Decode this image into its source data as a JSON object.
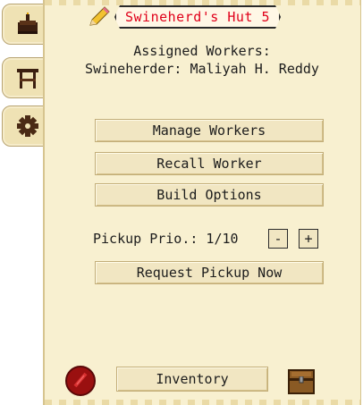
{
  "side_tabs": [
    {
      "icon": "cake-icon"
    },
    {
      "icon": "workbench-icon"
    },
    {
      "icon": "gear-icon"
    }
  ],
  "header": {
    "title": "Swineherd's Hut 5",
    "edit_icon": "pencil-icon",
    "title_color": "#e0001a"
  },
  "info": {
    "assigned_heading": "Assigned Workers:",
    "worker_line": "Swineherder: Maliyah H. Reddy"
  },
  "buttons": {
    "manage_workers": "Manage Workers",
    "recall_worker": "Recall Worker",
    "build_options": "Build Options",
    "request_pickup": "Request Pickup Now"
  },
  "pickup_priority": {
    "label": "Pickup Prio.: 1/10",
    "decrease": "-",
    "increase": "+"
  },
  "footer": {
    "help_icon": "help-icon",
    "inventory_label": "Inventory",
    "chest_icon": "chest-icon"
  }
}
